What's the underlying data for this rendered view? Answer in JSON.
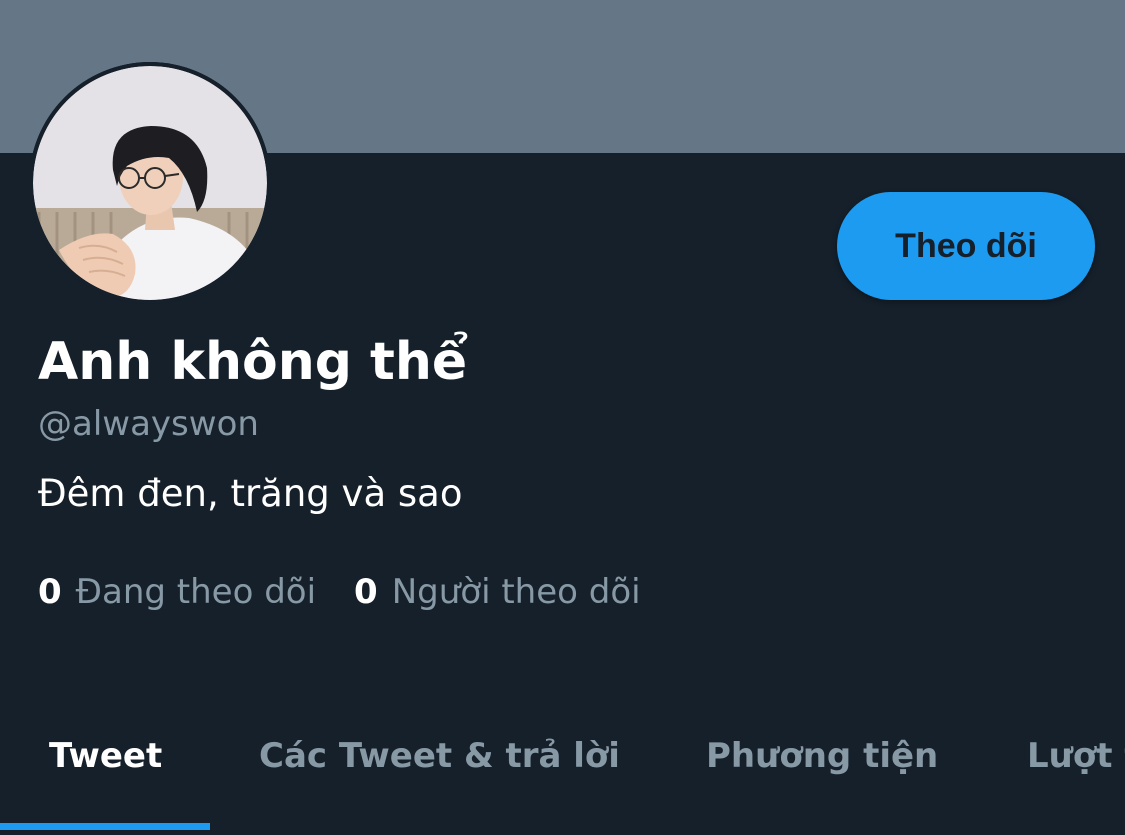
{
  "profile": {
    "display_name": "Anh không thể",
    "handle": "@alwayswon",
    "bio": "Đêm đen, trăng và sao",
    "avatar_icon": "profile-photo",
    "follow_label": "Theo dõi"
  },
  "stats": {
    "following_count": "0",
    "following_label": "Đang theo dõi",
    "followers_count": "0",
    "followers_label": "Người theo dõi"
  },
  "tabs": [
    {
      "label": "Tweet",
      "active": true
    },
    {
      "label": "Các Tweet & trả lời",
      "active": false
    },
    {
      "label": "Phương tiện",
      "active": false
    },
    {
      "label": "Lượt thích",
      "active": false
    }
  ],
  "colors": {
    "background": "#15202b",
    "banner": "#657786",
    "accent": "#1d9bf0",
    "secondary_text": "#8899a6"
  }
}
